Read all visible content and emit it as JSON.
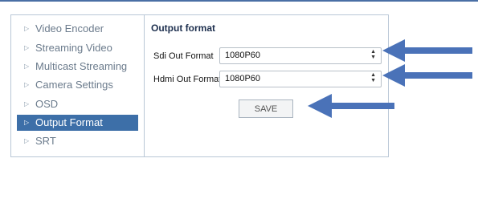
{
  "sidebar": {
    "items": [
      {
        "label": "Video Encoder",
        "active": false
      },
      {
        "label": "Streaming Video",
        "active": false
      },
      {
        "label": "Multicast Streaming",
        "active": false
      },
      {
        "label": "Camera Settings",
        "active": false
      },
      {
        "label": "OSD",
        "active": false
      },
      {
        "label": "Output Format",
        "active": true
      },
      {
        "label": "SRT",
        "active": false
      }
    ]
  },
  "main": {
    "title": "Output format",
    "fields": [
      {
        "label": "Sdi Out Format",
        "value": "1080P60"
      },
      {
        "label": "Hdmi Out Format",
        "value": "1080P60"
      }
    ],
    "save_label": "SAVE"
  },
  "colors": {
    "accent": "#3d6fa8",
    "annotation_arrow": "#4a72b8"
  },
  "icons": {
    "nav_bullet": "triangle-right-icon",
    "select_arrows": "up-down-arrows-icon",
    "annotation": "left-arrow-icon"
  }
}
